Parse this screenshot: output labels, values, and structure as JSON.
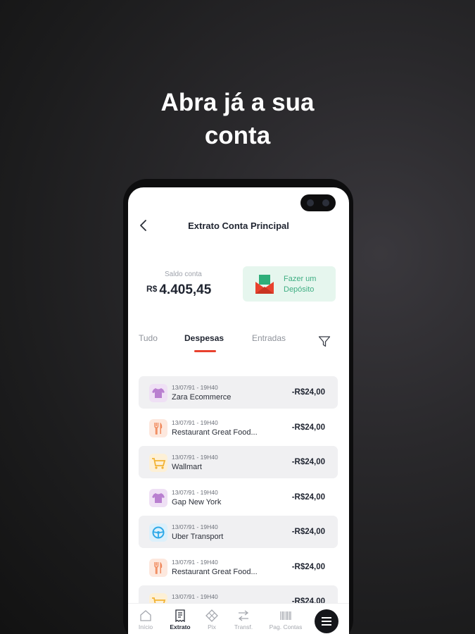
{
  "headline": {
    "line1": "Abra já a sua",
    "line2": "conta"
  },
  "header": {
    "title": "Extrato Conta Principal"
  },
  "balance": {
    "label": "Saldo conta",
    "currency": "R$",
    "value": "4.405,45"
  },
  "deposit": {
    "line1": "Fazer um",
    "line2": "Depósito"
  },
  "tabs": [
    {
      "label": "Tudo"
    },
    {
      "label": "Despesas"
    },
    {
      "label": "Entradas"
    }
  ],
  "active_tab": "Despesas",
  "transactions": [
    {
      "date": "13/07/91 - 19H40",
      "name": "Zara Ecommerce",
      "amount": "-R$24,00",
      "icon": "shirt-icon"
    },
    {
      "date": "13/07/91 - 19H40",
      "name": "Restaurant Great Food...",
      "amount": "-R$24,00",
      "icon": "cutlery-icon"
    },
    {
      "date": "13/07/91 - 19H40",
      "name": "Wallmart",
      "amount": "-R$24,00",
      "icon": "cart-icon"
    },
    {
      "date": "13/07/91 - 19H40",
      "name": "Gap New York",
      "amount": "-R$24,00",
      "icon": "shirt-icon"
    },
    {
      "date": "13/07/91 - 19H40",
      "name": "Uber Transport",
      "amount": "-R$24,00",
      "icon": "steering-wheel-icon"
    },
    {
      "date": "13/07/91 - 19H40",
      "name": "Restaurant Great Food...",
      "amount": "-R$24,00",
      "icon": "cutlery-icon"
    },
    {
      "date": "13/07/91 - 19H40",
      "name": "",
      "amount": "-R$24,00",
      "icon": "cart-icon"
    }
  ],
  "nav": [
    {
      "label": "Início",
      "icon": "home-icon"
    },
    {
      "label": "Extrato",
      "icon": "receipt-icon"
    },
    {
      "label": "Pix",
      "icon": "pix-icon"
    },
    {
      "label": "Transf.",
      "icon": "transfer-icon"
    },
    {
      "label": "Pag. Contas",
      "icon": "barcode-icon"
    }
  ],
  "colors": {
    "accent": "#e8412e",
    "deposit_bg": "#e6f6ee",
    "deposit_text": "#3fae83",
    "shirt": "#b97fd0",
    "food": "#f08a5d",
    "cart": "#f2b233",
    "uber": "#2ea9e8"
  }
}
